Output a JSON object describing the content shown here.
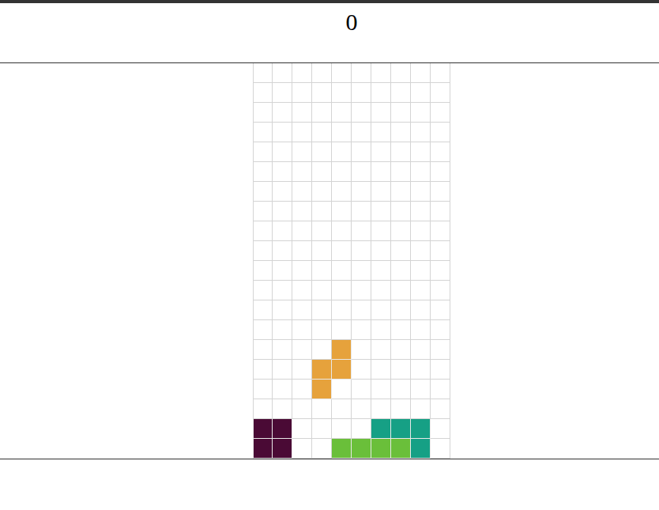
{
  "score": "0",
  "board": {
    "rows": 20,
    "cols": 10
  },
  "pieces": [
    {
      "kind": "S",
      "falling": true,
      "color": "#e6a23c",
      "cells": [
        [
          14,
          4
        ],
        [
          15,
          3
        ],
        [
          15,
          4
        ],
        [
          16,
          3
        ]
      ]
    },
    {
      "kind": "O",
      "falling": false,
      "color": "#4a0a35",
      "cells": [
        [
          18,
          0
        ],
        [
          18,
          1
        ],
        [
          19,
          0
        ],
        [
          19,
          1
        ]
      ]
    },
    {
      "kind": "J",
      "falling": false,
      "color": "#16a085",
      "cells": [
        [
          18,
          6
        ],
        [
          18,
          7
        ],
        [
          18,
          8
        ],
        [
          19,
          8
        ]
      ]
    },
    {
      "kind": "I",
      "falling": false,
      "color": "#6abf3a",
      "cells": [
        [
          19,
          4
        ],
        [
          19,
          5
        ],
        [
          19,
          6
        ],
        [
          19,
          7
        ]
      ]
    }
  ]
}
